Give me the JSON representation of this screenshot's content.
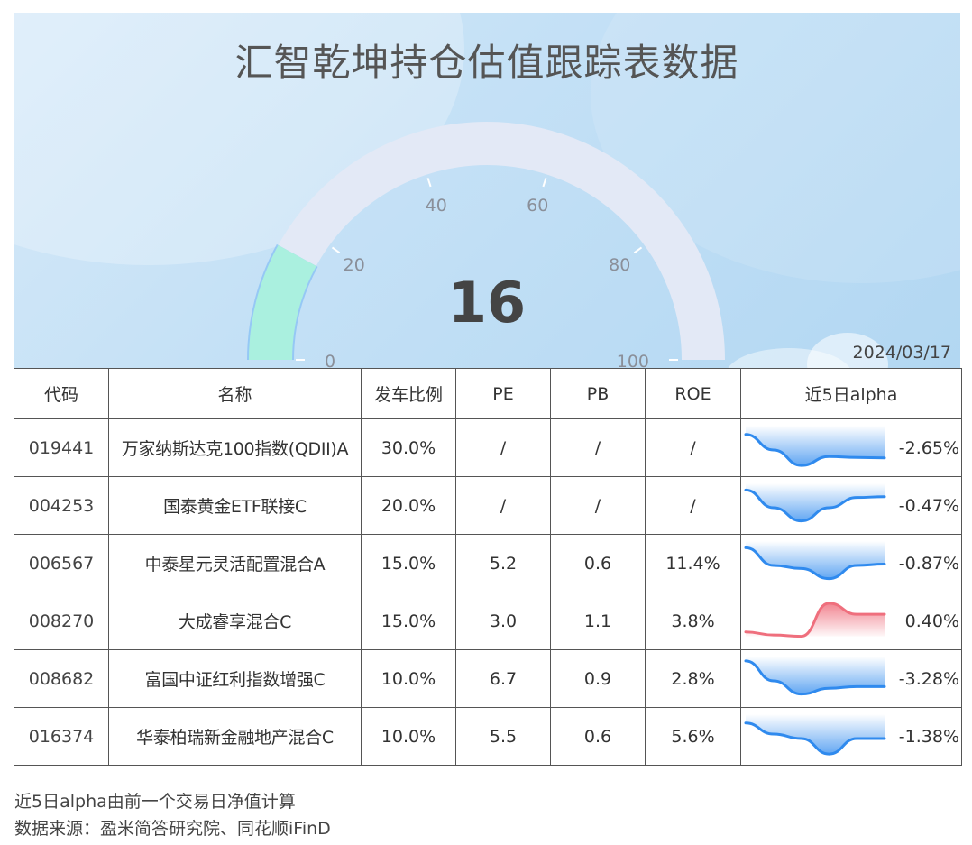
{
  "header": {
    "title": "汇智乾坤持仓估值跟踪表数据",
    "date": "2024/03/17"
  },
  "gauge": {
    "value": 16,
    "display_value": "16",
    "min": 0,
    "max": 100,
    "ticks": [
      "0",
      "20",
      "40",
      "60",
      "80",
      "100"
    ],
    "fill_color": "#aaf0df",
    "track_color": "#e3e9f6"
  },
  "table": {
    "headers": {
      "code": "代码",
      "name": "名称",
      "ratio": "发车比例",
      "pe": "PE",
      "pb": "PB",
      "roe": "ROE",
      "alpha": "近5日alpha"
    },
    "rows": [
      {
        "code": "019441",
        "name": "万家纳斯达克100指数(QDII)A",
        "ratio": "30.0%",
        "pe": "/",
        "pb": "/",
        "roe": "/",
        "alpha": "-2.65%",
        "alpha_value": -2.65,
        "trend": [
          0.2,
          0.55,
          0.9,
          0.7,
          0.72,
          0.73
        ],
        "color": "blue"
      },
      {
        "code": "004253",
        "name": "国泰黄金ETF联接C",
        "ratio": "20.0%",
        "pe": "/",
        "pb": "/",
        "roe": "/",
        "alpha": "-0.47%",
        "alpha_value": -0.47,
        "trend": [
          0.15,
          0.55,
          0.85,
          0.55,
          0.32,
          0.3
        ],
        "color": "blue"
      },
      {
        "code": "006567",
        "name": "中泰星元灵活配置混合A",
        "ratio": "15.0%",
        "pe": "5.2",
        "pb": "0.6",
        "roe": "11.4%",
        "alpha": "-0.87%",
        "alpha_value": -0.87,
        "trend": [
          0.15,
          0.55,
          0.62,
          0.85,
          0.55,
          0.52
        ],
        "color": "blue"
      },
      {
        "code": "008270",
        "name": "大成睿享混合C",
        "ratio": "15.0%",
        "pe": "3.0",
        "pb": "1.1",
        "roe": "3.8%",
        "alpha": "0.40%",
        "alpha_value": 0.4,
        "trend": [
          0.75,
          0.82,
          0.85,
          0.1,
          0.35,
          0.35
        ],
        "color": "red"
      },
      {
        "code": "008682",
        "name": "富国中证红利指数增强C",
        "ratio": "10.0%",
        "pe": "6.7",
        "pb": "0.9",
        "roe": "2.8%",
        "alpha": "-3.28%",
        "alpha_value": -3.28,
        "trend": [
          0.1,
          0.55,
          0.85,
          0.72,
          0.68,
          0.68
        ],
        "color": "blue"
      },
      {
        "code": "016374",
        "name": "华泰柏瑞新金融地产混合C",
        "ratio": "10.0%",
        "pe": "5.5",
        "pb": "0.6",
        "roe": "5.6%",
        "alpha": "-1.38%",
        "alpha_value": -1.38,
        "trend": [
          0.2,
          0.45,
          0.55,
          0.9,
          0.55,
          0.55
        ],
        "color": "blue"
      }
    ]
  },
  "colors": {
    "sparkline_blue": "#2f8aee",
    "sparkline_red": "#ef6f7d"
  },
  "notes": {
    "line1": "近5日alpha由前一个交易日净值计算",
    "line2": "数据来源：盈米简答研究院、同花顺iFinD"
  }
}
